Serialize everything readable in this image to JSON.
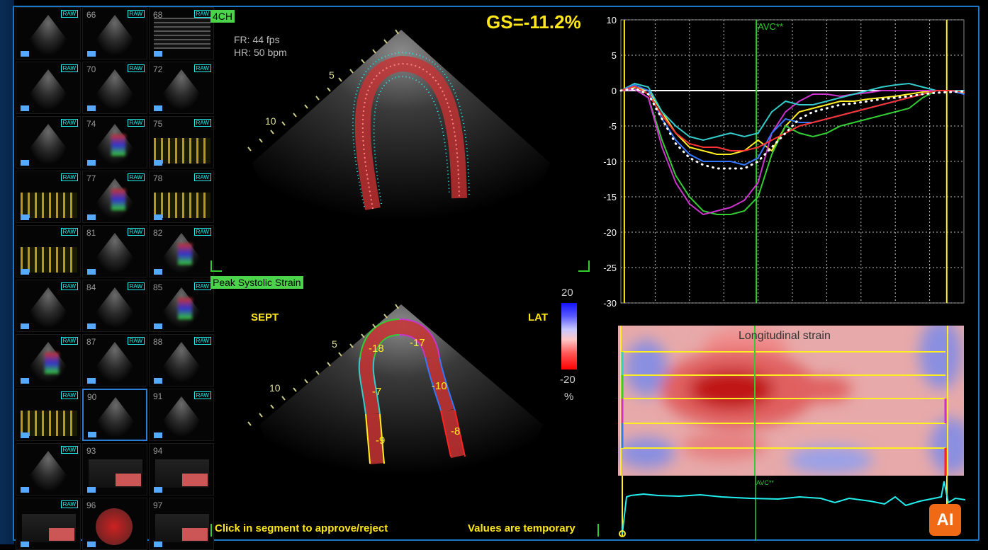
{
  "thumbnails": [
    {
      "n": "",
      "raw": "RAW",
      "kind": "echo",
      "col": 0,
      "row": 0
    },
    {
      "n": "66",
      "raw": "RAW",
      "kind": "echo",
      "col": 1,
      "row": 0
    },
    {
      "n": "68",
      "raw": "RAW",
      "kind": "mmode",
      "col": 2,
      "row": 0
    },
    {
      "n": "",
      "raw": "RAW",
      "kind": "echo",
      "col": 0,
      "row": 1
    },
    {
      "n": "70",
      "raw": "RAW",
      "kind": "echo",
      "col": 1,
      "row": 1
    },
    {
      "n": "72",
      "raw": "RAW",
      "kind": "echo",
      "col": 2,
      "row": 1
    },
    {
      "n": "",
      "raw": "RAW",
      "kind": "echo",
      "col": 0,
      "row": 2
    },
    {
      "n": "74",
      "raw": "RAW",
      "kind": "color",
      "col": 1,
      "row": 2
    },
    {
      "n": "75",
      "raw": "RAW",
      "kind": "doppler",
      "col": 2,
      "row": 2
    },
    {
      "n": "",
      "raw": "RAW",
      "kind": "doppler",
      "col": 0,
      "row": 3
    },
    {
      "n": "77",
      "raw": "RAW",
      "kind": "color",
      "col": 1,
      "row": 3
    },
    {
      "n": "78",
      "raw": "RAW",
      "kind": "doppler",
      "col": 2,
      "row": 3
    },
    {
      "n": "",
      "raw": "RAW",
      "kind": "doppler",
      "col": 0,
      "row": 4
    },
    {
      "n": "81",
      "raw": "RAW",
      "kind": "echo",
      "col": 1,
      "row": 4
    },
    {
      "n": "82",
      "raw": "RAW",
      "kind": "color",
      "col": 2,
      "row": 4
    },
    {
      "n": "",
      "raw": "RAW",
      "kind": "echo",
      "col": 0,
      "row": 5
    },
    {
      "n": "84",
      "raw": "RAW",
      "kind": "echo",
      "col": 1,
      "row": 5
    },
    {
      "n": "85",
      "raw": "RAW",
      "kind": "color",
      "col": 2,
      "row": 5
    },
    {
      "n": "",
      "raw": "RAW",
      "kind": "color",
      "col": 0,
      "row": 6
    },
    {
      "n": "87",
      "raw": "RAW",
      "kind": "echo",
      "col": 1,
      "row": 6
    },
    {
      "n": "88",
      "raw": "RAW",
      "kind": "echo",
      "col": 2,
      "row": 6
    },
    {
      "n": "",
      "raw": "RAW",
      "kind": "doppler",
      "col": 0,
      "row": 7
    },
    {
      "n": "90",
      "raw": "",
      "kind": "echo",
      "col": 1,
      "row": 7,
      "selected": true
    },
    {
      "n": "91",
      "raw": "RAW",
      "kind": "echo",
      "col": 2,
      "row": 7
    },
    {
      "n": "",
      "raw": "RAW",
      "kind": "echo",
      "col": 0,
      "row": 8
    },
    {
      "n": "93",
      "raw": "",
      "kind": "mini",
      "col": 1,
      "row": 8
    },
    {
      "n": "94",
      "raw": "",
      "kind": "mini",
      "col": 2,
      "row": 8
    },
    {
      "n": "",
      "raw": "RAW",
      "kind": "mini",
      "col": 0,
      "row": 9
    },
    {
      "n": "96",
      "raw": "",
      "kind": "bull",
      "col": 1,
      "row": 9
    },
    {
      "n": "97",
      "raw": "",
      "kind": "mini",
      "col": 2,
      "row": 9
    }
  ],
  "view": {
    "tag": "4CH",
    "fr": "FR: 44 fps",
    "hr": "HR: 50 bpm",
    "gs": "GS=-11.2%",
    "depth_top_5": "5",
    "depth_top_10": "10",
    "depth_bot_5": "5",
    "depth_bot_10": "10"
  },
  "strain_view": {
    "tag": "Peak Systolic Strain",
    "sept": "SEPT",
    "lat": "LAT",
    "segments": [
      {
        "label": "-18",
        "color": "#33cc33"
      },
      {
        "label": "-17",
        "color": "#cc33cc"
      },
      {
        "label": "-7",
        "color": "#33cccc"
      },
      {
        "label": "-10",
        "color": "#3377ff"
      },
      {
        "label": "-9",
        "color": "#ffee22"
      },
      {
        "label": "-8",
        "color": "#ff2222"
      }
    ],
    "colorbar_max": "20",
    "colorbar_min": "-20",
    "colorbar_unit": "%"
  },
  "notes": {
    "left": "Click in segment to approve/reject",
    "right": "Values are temporary"
  },
  "chart_data": {
    "type": "line",
    "ylim": [
      -30,
      10
    ],
    "yticks": [
      "10",
      "5",
      "0",
      "-5",
      "-10",
      "-15",
      "-20",
      "-25",
      "-30"
    ],
    "avc_label": "AVC**",
    "x": [
      0,
      4,
      8,
      12,
      16,
      20,
      24,
      28,
      32,
      36,
      40,
      44,
      48,
      52,
      56,
      60,
      64,
      68,
      72,
      76,
      80,
      84,
      88,
      92,
      96,
      100
    ],
    "series": [
      {
        "color": "#ffee22",
        "values": [
          0,
          0.5,
          0,
          -3,
          -6,
          -8,
          -8.5,
          -9,
          -9,
          -8.5,
          -7,
          -8.5,
          -5,
          -3,
          -2.5,
          -2,
          -1.5,
          -1.5,
          -1.2,
          -1,
          -0.8,
          -0.5,
          -0.2,
          0,
          0,
          -0.3
        ]
      },
      {
        "color": "#33cc33",
        "values": [
          0,
          0.3,
          -1,
          -7,
          -12,
          -15,
          -17,
          -17.5,
          -17.5,
          -17,
          -15,
          -9,
          -5,
          -6,
          -6.5,
          -6,
          -5,
          -4.5,
          -4,
          -3.5,
          -3,
          -2.5,
          -1,
          0,
          0,
          0
        ]
      },
      {
        "color": "#cc33cc",
        "values": [
          0,
          0.2,
          -1,
          -8,
          -13,
          -16,
          -17.5,
          -17,
          -16.5,
          -15.5,
          -13,
          -6,
          -3,
          -1.5,
          -0.5,
          -0.5,
          -0.8,
          -0.5,
          -0.3,
          0,
          0,
          0,
          0,
          0,
          0,
          0
        ]
      },
      {
        "color": "#33cccc",
        "values": [
          0,
          1,
          0.5,
          -3,
          -5,
          -6.5,
          -7,
          -6.5,
          -6,
          -6.5,
          -6,
          -3,
          -1.5,
          -2,
          -2,
          -1.5,
          -1,
          -0.5,
          0,
          0.5,
          0.8,
          1,
          0.5,
          0,
          0,
          0
        ]
      },
      {
        "color": "#3377ff",
        "values": [
          0,
          0.8,
          0,
          -4,
          -7,
          -9,
          -10,
          -10,
          -10,
          -10.5,
          -9.5,
          -6,
          -4,
          -4.5,
          -4.5,
          -4,
          -3.5,
          -3,
          -2.5,
          -2,
          -1.5,
          -1,
          -0.5,
          0,
          0,
          -0.5
        ]
      },
      {
        "color": "#ff3333",
        "values": [
          0,
          0.6,
          -0.5,
          -3.5,
          -6,
          -7.5,
          -8,
          -8,
          -8.5,
          -8.5,
          -8,
          -7,
          -6,
          -5,
          -4.5,
          -4,
          -3.5,
          -3,
          -2.5,
          -2,
          -1.5,
          -1,
          -0.5,
          0,
          0,
          -0.2
        ]
      },
      {
        "color": "#ffffff",
        "dotted": true,
        "values": [
          0,
          0.3,
          -0.5,
          -4,
          -7.5,
          -9.5,
          -10.5,
          -11,
          -11,
          -11,
          -10,
          -8,
          -6,
          -4,
          -3,
          -2.5,
          -2,
          -1.8,
          -1.5,
          -1.2,
          -1,
          -0.8,
          -0.5,
          -0.3,
          -0.2,
          -0.1
        ]
      }
    ]
  },
  "strainmap": {
    "title": "Longitudinal strain",
    "ecg_avc": "AVC**"
  },
  "ai_badge": "AI"
}
